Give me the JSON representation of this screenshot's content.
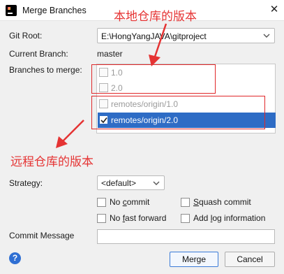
{
  "window": {
    "title": "Merge Branches"
  },
  "form": {
    "git_root_label": "Git Root:",
    "git_root_value": "E:\\HongYangJAVA\\gitproject",
    "current_branch_label": "Current Branch:",
    "current_branch_value": "master",
    "branches_label": "Branches to merge:",
    "branches": [
      {
        "label": "1.0",
        "checked": false,
        "enabled": false
      },
      {
        "label": "2.0",
        "checked": false,
        "enabled": false
      },
      {
        "label": "remotes/origin/1.0",
        "checked": false,
        "enabled": false
      },
      {
        "label": "remotes/origin/2.0",
        "checked": true,
        "enabled": true,
        "selected": true
      }
    ],
    "strategy_label": "Strategy:",
    "strategy_value": "<default>",
    "options": {
      "no_commit": "No commit",
      "squash_commit": "Squash commit",
      "no_fast_forward": "No fast forward",
      "add_log": "Add log information"
    },
    "commit_message_label": "Commit Message",
    "commit_message_value": ""
  },
  "annotations": {
    "local": "本地仓库的版本",
    "remote": "远程仓库的版本"
  },
  "buttons": {
    "help": "?",
    "merge": "Merge",
    "cancel": "Cancel"
  },
  "colors": {
    "selection": "#2e6cc5",
    "annotation": "#e0282a",
    "help": "#2f6fd3"
  }
}
